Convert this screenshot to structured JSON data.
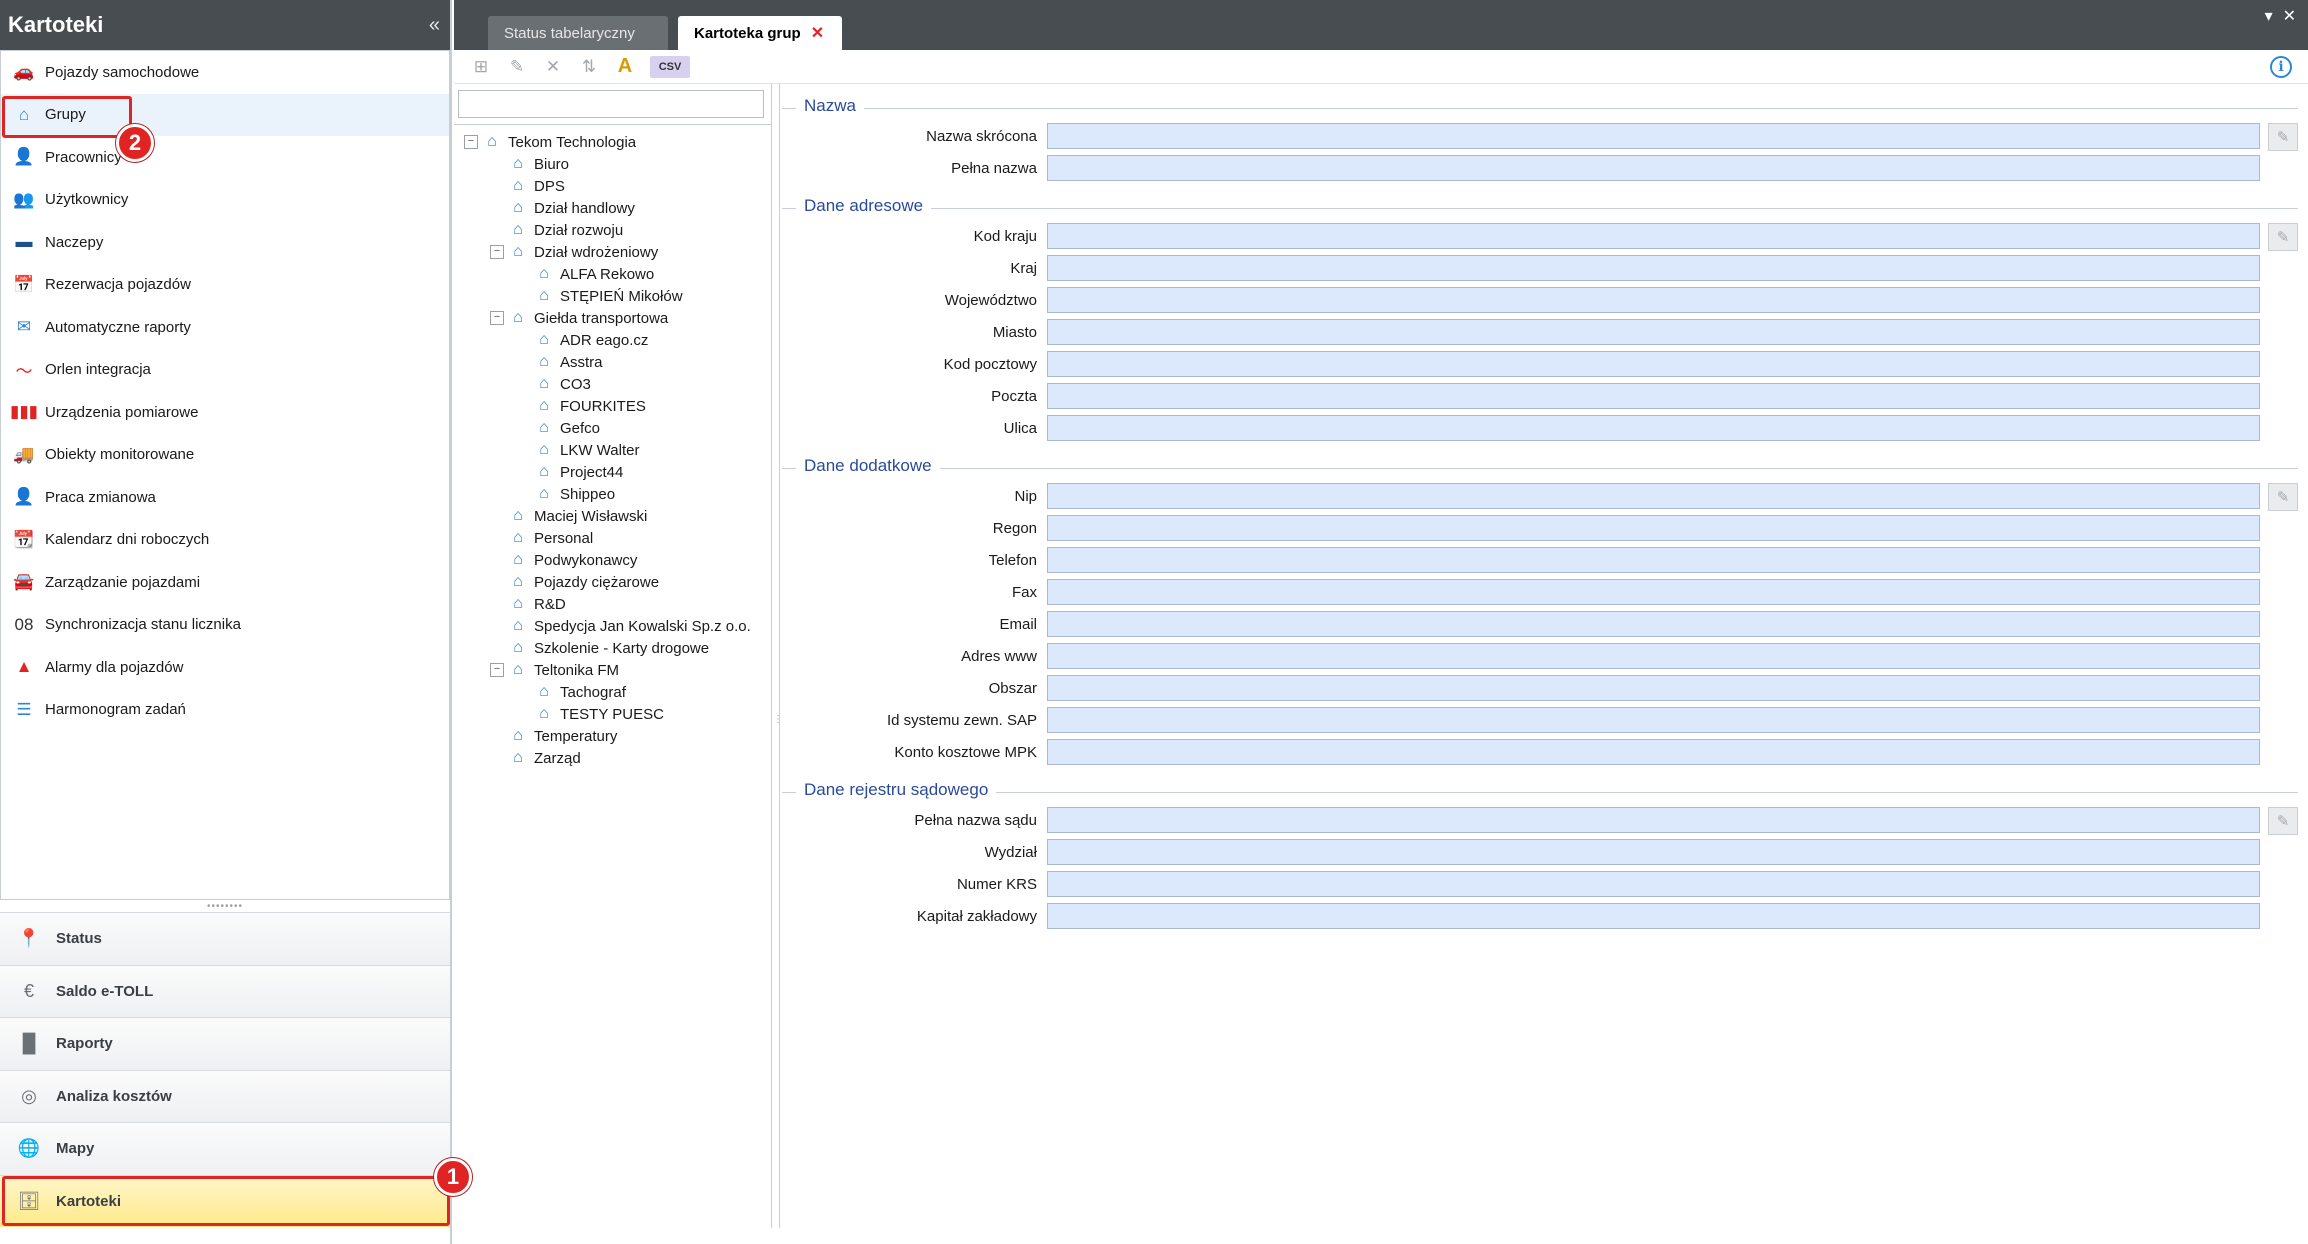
{
  "left_panel": {
    "title": "Kartoteki",
    "collapse_glyph": "«",
    "items": [
      {
        "label": "Pojazdy samochodowe",
        "icon": "car-icon",
        "glyph": "🚗",
        "color": "#f0a500"
      },
      {
        "label": "Grupy",
        "icon": "home-icon",
        "glyph": "⌂",
        "color": "#2e86d6"
      },
      {
        "label": "Pracownicy",
        "icon": "user-icon",
        "glyph": "👤",
        "color": "#2e86d6"
      },
      {
        "label": "Użytkownicy",
        "icon": "users-icon",
        "glyph": "👥",
        "color": "#3aa63a"
      },
      {
        "label": "Naczepy",
        "icon": "trailer-icon",
        "glyph": "▬",
        "color": "#1f4f8f"
      },
      {
        "label": "Rezerwacja pojazdów",
        "icon": "calendar-icon",
        "glyph": "📅",
        "color": "#2e86d6"
      },
      {
        "label": "Automatyczne raporty",
        "icon": "mail-clock-icon",
        "glyph": "✉",
        "color": "#2e86d6"
      },
      {
        "label": "Orlen integracja",
        "icon": "orlen-icon",
        "glyph": "〜",
        "color": "#e02424"
      },
      {
        "label": "Urządzenia pomiarowe",
        "icon": "meter-icon",
        "glyph": "▮▮▮",
        "color": "#e02424"
      },
      {
        "label": "Obiekty monitorowane",
        "icon": "truck-icon",
        "glyph": "🚚",
        "color": "#2e86d6"
      },
      {
        "label": "Praca zmianowa",
        "icon": "shift-icon",
        "glyph": "👤",
        "color": "#333333"
      },
      {
        "label": "Kalendarz dni roboczych",
        "icon": "calendar-days-icon",
        "glyph": "📆",
        "color": "#2e86d6"
      },
      {
        "label": "Zarządzanie pojazdami",
        "icon": "vehicle-manage-icon",
        "glyph": "🚘",
        "color": "#2e86d6"
      },
      {
        "label": "Synchronizacja stanu licznika",
        "icon": "counter-icon",
        "glyph": "08",
        "color": "#333333"
      },
      {
        "label": "Alarmy dla pojazdów",
        "icon": "alarm-icon",
        "glyph": "▲",
        "color": "#e02424"
      },
      {
        "label": "Harmonogram zadań",
        "icon": "schedule-icon",
        "glyph": "☰",
        "color": "#2e86d6"
      }
    ],
    "selected_index": 1,
    "bottom": [
      {
        "label": "Status",
        "icon": "pin-icon",
        "glyph": "📍"
      },
      {
        "label": "Saldo e-TOLL",
        "icon": "toll-icon",
        "glyph": "€"
      },
      {
        "label": "Raporty",
        "icon": "bar-chart-icon",
        "glyph": "▐▌"
      },
      {
        "label": "Analiza kosztów",
        "icon": "coins-icon",
        "glyph": "◎"
      },
      {
        "label": "Mapy",
        "icon": "globe-icon",
        "glyph": "🌐"
      },
      {
        "label": "Kartoteki",
        "icon": "cabinet-icon",
        "glyph": "🗄"
      }
    ],
    "active_bottom_index": 5
  },
  "callouts": {
    "first": "1",
    "second": "2"
  },
  "tabs": {
    "status": "Status tabelaryczny",
    "kartoteka": "Kartoteka grup",
    "close_glyph": "✕"
  },
  "toolbar": {
    "add_glyph": "⊞",
    "edit_glyph": "✎",
    "delete_glyph": "✕",
    "move_glyph": "⇅",
    "warn_glyph": "A",
    "csv_label": "CSV",
    "info_glyph": "i"
  },
  "tree": {
    "search_value": "",
    "nodes": [
      {
        "label": "Tekom Technologia",
        "level": 0,
        "expandable": true
      },
      {
        "label": "Biuro",
        "level": 1
      },
      {
        "label": "DPS",
        "level": 1
      },
      {
        "label": "Dział handlowy",
        "level": 1
      },
      {
        "label": "Dział rozwoju",
        "level": 1
      },
      {
        "label": "Dział wdrożeniowy",
        "level": 1,
        "expandable": true
      },
      {
        "label": "ALFA Rekowo",
        "level": 2
      },
      {
        "label": "STĘPIEŃ Mikołów",
        "level": 2
      },
      {
        "label": "Giełda transportowa",
        "level": 1,
        "expandable": true
      },
      {
        "label": "ADR eago.cz",
        "level": 2
      },
      {
        "label": "Asstra",
        "level": 2
      },
      {
        "label": "CO3",
        "level": 2
      },
      {
        "label": "FOURKITES",
        "level": 2
      },
      {
        "label": "Gefco",
        "level": 2
      },
      {
        "label": "LKW Walter",
        "level": 2
      },
      {
        "label": "Project44",
        "level": 2
      },
      {
        "label": "Shippeo",
        "level": 2
      },
      {
        "label": "Maciej Wisławski",
        "level": 1
      },
      {
        "label": "Personal",
        "level": 1
      },
      {
        "label": "Podwykonawcy",
        "level": 1
      },
      {
        "label": "Pojazdy ciężarowe",
        "level": 1
      },
      {
        "label": "R&D",
        "level": 1
      },
      {
        "label": "Spedycja Jan Kowalski Sp.z o.o.",
        "level": 1
      },
      {
        "label": "Szkolenie - Karty drogowe",
        "level": 1
      },
      {
        "label": "Teltonika FM",
        "level": 1,
        "expandable": true
      },
      {
        "label": "Tachograf",
        "level": 2
      },
      {
        "label": "TESTY PUESC",
        "level": 2
      },
      {
        "label": "Temperatury",
        "level": 1
      },
      {
        "label": "Zarząd",
        "level": 1
      }
    ]
  },
  "form": {
    "sections": [
      {
        "title": "Nazwa",
        "fields": [
          {
            "label": "Nazwa skrócona",
            "value": "",
            "edit": true
          },
          {
            "label": "Pełna nazwa",
            "value": ""
          }
        ]
      },
      {
        "title": "Dane adresowe",
        "fields": [
          {
            "label": "Kod kraju",
            "value": "",
            "edit": true
          },
          {
            "label": "Kraj",
            "value": ""
          },
          {
            "label": "Województwo",
            "value": ""
          },
          {
            "label": "Miasto",
            "value": ""
          },
          {
            "label": "Kod pocztowy",
            "value": ""
          },
          {
            "label": "Poczta",
            "value": ""
          },
          {
            "label": "Ulica",
            "value": ""
          }
        ]
      },
      {
        "title": "Dane dodatkowe",
        "fields": [
          {
            "label": "Nip",
            "value": "",
            "edit": true
          },
          {
            "label": "Regon",
            "value": ""
          },
          {
            "label": "Telefon",
            "value": ""
          },
          {
            "label": "Fax",
            "value": ""
          },
          {
            "label": "Email",
            "value": ""
          },
          {
            "label": "Adres www",
            "value": ""
          },
          {
            "label": "Obszar",
            "value": ""
          },
          {
            "label": "Id systemu zewn. SAP",
            "value": ""
          },
          {
            "label": "Konto kosztowe MPK",
            "value": ""
          }
        ]
      },
      {
        "title": "Dane rejestru sądowego",
        "fields": [
          {
            "label": "Pełna nazwa sądu",
            "value": "",
            "edit": true
          },
          {
            "label": "Wydział",
            "value": ""
          },
          {
            "label": "Numer KRS",
            "value": ""
          },
          {
            "label": "Kapitał zakładowy",
            "value": ""
          }
        ]
      }
    ],
    "edit_glyph": "✎"
  },
  "colors": {
    "accent": "#2e86d6",
    "header": "#484d52",
    "callout": "#e02424",
    "input_bg": "#dce8fb"
  }
}
